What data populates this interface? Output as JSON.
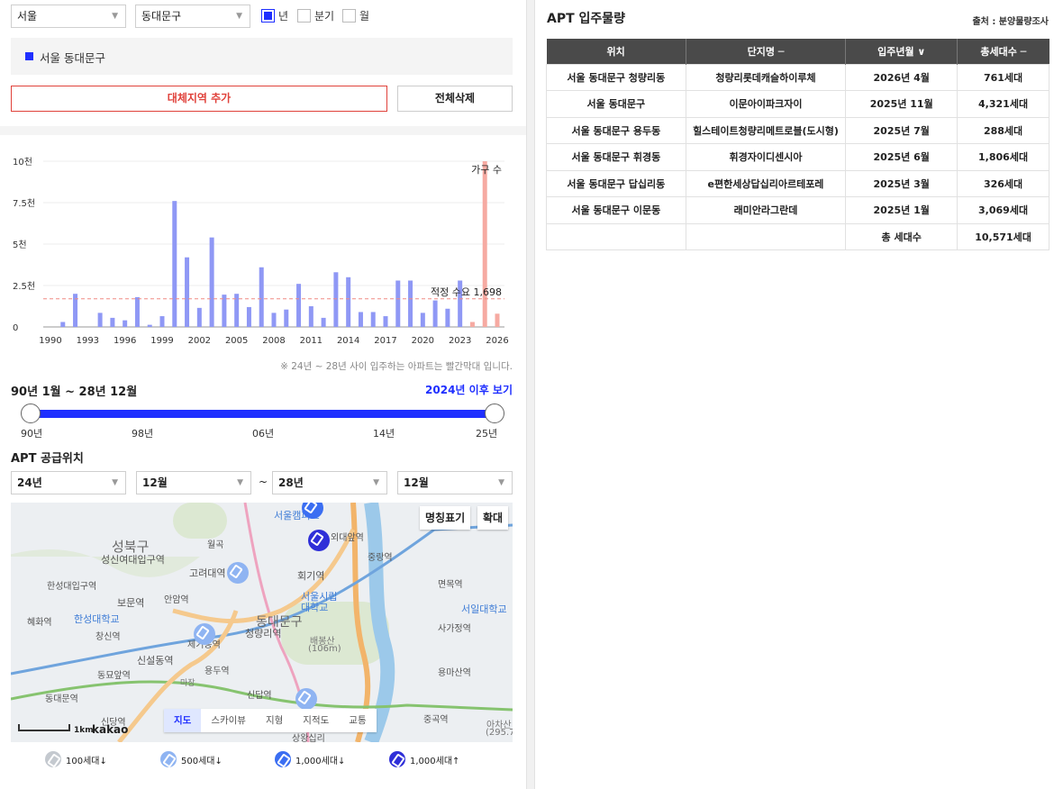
{
  "filters": {
    "city": "서울",
    "district": "동대문구",
    "period_options": [
      {
        "label": "년",
        "checked": true
      },
      {
        "label": "분기",
        "checked": false
      },
      {
        "label": "월",
        "checked": false
      }
    ]
  },
  "region": {
    "selected": "서울 동대문구"
  },
  "buttons": {
    "add_region": "대체지역 추가",
    "clear_all": "전체삭제"
  },
  "chart_data": {
    "type": "bar",
    "legend": "가구 수",
    "y_ticks": [
      "10천",
      "7.5천",
      "5천",
      "2.5천",
      "0"
    ],
    "x_ticks": [
      "1990",
      "1993",
      "1996",
      "1999",
      "2002",
      "2005",
      "2008",
      "2011",
      "2014",
      "2017",
      "2020",
      "2023",
      "2026"
    ],
    "ylim": [
      0,
      10000
    ],
    "x": [
      1990,
      1991,
      1992,
      1993,
      1994,
      1995,
      1996,
      1997,
      1998,
      1999,
      2000,
      2001,
      2002,
      2003,
      2004,
      2005,
      2006,
      2007,
      2008,
      2009,
      2010,
      2011,
      2012,
      2013,
      2014,
      2015,
      2016,
      2017,
      2018,
      2019,
      2020,
      2021,
      2022,
      2023,
      2024,
      2025,
      2026
    ],
    "values": [
      0,
      300,
      2000,
      0,
      850,
      550,
      400,
      1800,
      130,
      650,
      7600,
      4200,
      1150,
      5400,
      1950,
      2000,
      1200,
      3600,
      850,
      1050,
      2600,
      1250,
      550,
      3300,
      3000,
      900,
      900,
      650,
      2800,
      2800,
      850,
      1600,
      1100,
      2800,
      300,
      10000,
      800
    ],
    "highlight_from": 2024,
    "colors": {
      "normal": "#8f98f5",
      "highlight": "#f6aaa2",
      "ref_line": "#f08a84"
    },
    "reference": {
      "label": "적정 수요 1,698",
      "value": 1698
    }
  },
  "chart_note": "※ 24년 ~ 28년 사이 입주하는 아파트는 빨간막대 입니다.",
  "range": {
    "title": "90년 1월 ~ 28년 12월",
    "link": "2024년 이후 보기",
    "ticks": [
      "90년",
      "98년",
      "06년",
      "14년",
      "25년"
    ],
    "min_value": 0,
    "max_value": 1
  },
  "supply": {
    "title": "APT 공급위치",
    "from_year": "24년",
    "from_month": "12월",
    "tilde": "~",
    "to_year": "28년",
    "to_month": "12월"
  },
  "map": {
    "label_toggle": "명칭표기",
    "zoom": "확대",
    "tabs": [
      "지도",
      "스카이뷰",
      "지형",
      "지적도",
      "교통"
    ],
    "scale": "1km",
    "brand": "kakao",
    "places": [
      "성북구",
      "성신여대입구역",
      "고려대역",
      "회기역",
      "한성대입구역",
      "보문역",
      "안암역",
      "서울시립 대학교",
      "동대문구",
      "청량리역",
      "한성대학교",
      "혜화역",
      "창신역",
      "배봉산",
      "(106m)",
      "신설동역",
      "제기동역",
      "용두역",
      "동묘앞역",
      "동대문역",
      "신답역",
      "용마산역",
      "사가정역",
      "면목역",
      "서일대학교",
      "중랑역",
      "외대앞역",
      "서울캠퍼스",
      "월곡",
      "신당역",
      "중곡역",
      "마장",
      "아차산",
      "(295.7",
      "상왕십리"
    ],
    "legend": [
      "100세대↓",
      "500세대↓",
      "1,000세대↓",
      "1,000세대↑"
    ],
    "legend_colors": [
      "#c4c9cf",
      "#8fb4f2",
      "#3b6ef2",
      "#2f2fd8"
    ]
  },
  "apt_table": {
    "title": "APT 입주물량",
    "source": "출처 : 분양물량조사",
    "headers": [
      "위치",
      "단지명 ─",
      "입주년월 ∨",
      "총세대수 ─"
    ],
    "rows": [
      [
        "서울 동대문구 청량리동",
        "청량리롯데캐슬하이루체",
        "2026년 4월",
        "761세대"
      ],
      [
        "서울 동대문구",
        "이문아이파크자이",
        "2025년 11월",
        "4,321세대"
      ],
      [
        "서울 동대문구 용두동",
        "힐스테이트청량리메트로블(도시형)",
        "2025년 7월",
        "288세대"
      ],
      [
        "서울 동대문구 휘경동",
        "휘경자이디센시아",
        "2025년 6월",
        "1,806세대"
      ],
      [
        "서울 동대문구 답십리동",
        "e편한세상답십리아르테포레",
        "2025년 3월",
        "326세대"
      ],
      [
        "서울 동대문구 이문동",
        "래미안라그란데",
        "2025년 1월",
        "3,069세대"
      ]
    ],
    "total_label": "총 세대수",
    "total_value": "10,571세대"
  }
}
